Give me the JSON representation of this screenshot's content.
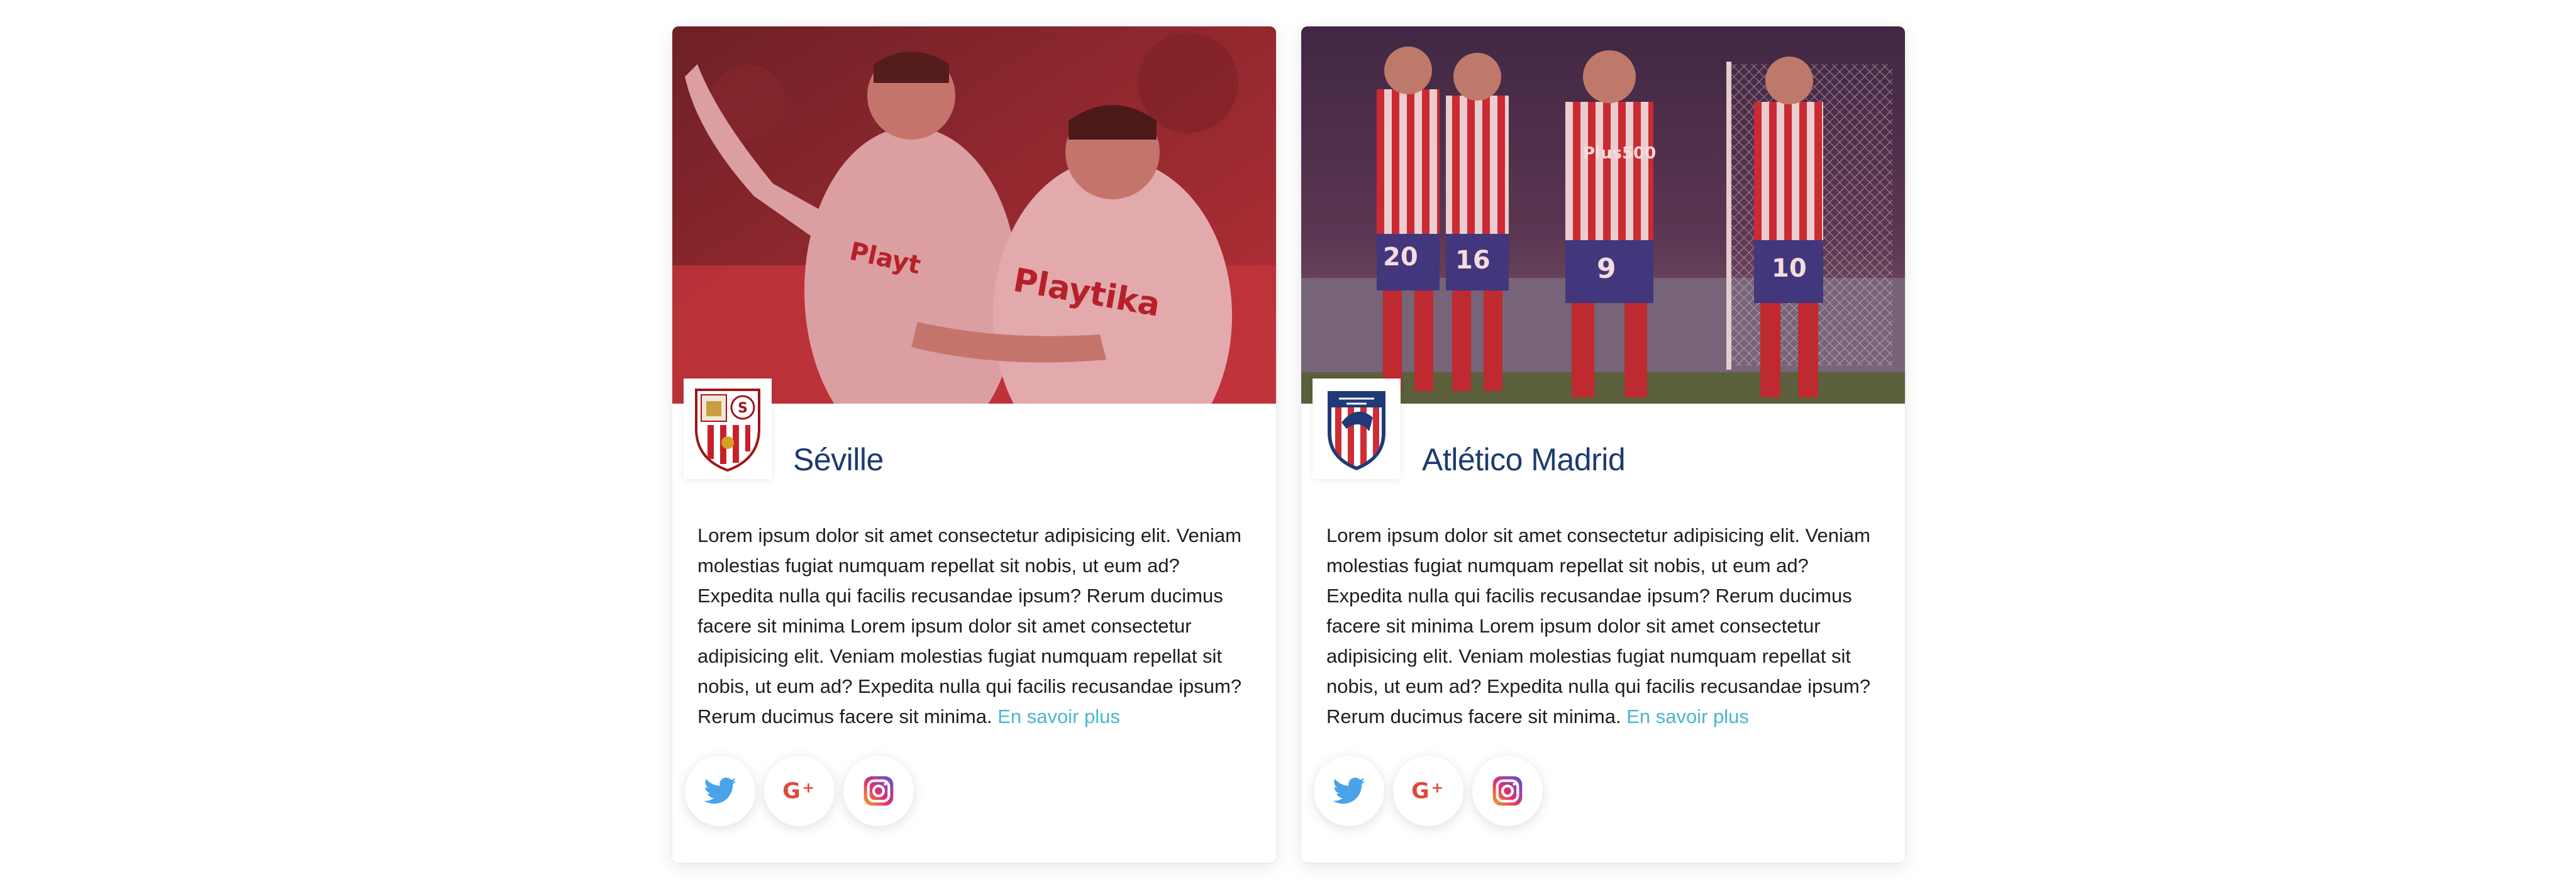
{
  "cards": [
    {
      "team": "Séville",
      "description": "Lorem ipsum dolor sit amet consectetur adipisicing elit. Veniam molestias fugiat numquam repellat sit nobis, ut eum ad? Expedita nulla qui facilis recusandae ipsum? Rerum ducimus facere sit minima Lorem ipsum dolor sit amet consectetur adipisicing elit. Veniam molestias fugiat numquam repellat sit nobis, ut eum ad? Expedita nulla qui facilis recusandae ipsum? Rerum ducimus facere sit minima. ",
      "more_link": "En savoir plus",
      "jersey_text": "Playtika",
      "socials": [
        "twitter-icon",
        "google-plus-icon",
        "instagram-icon"
      ]
    },
    {
      "team": "Atlético Madrid",
      "description": "Lorem ipsum dolor sit amet consectetur adipisicing elit. Veniam molestias fugiat numquam repellat sit nobis, ut eum ad? Expedita nulla qui facilis recusandae ipsum? Rerum ducimus facere sit minima Lorem ipsum dolor sit amet consectetur adipisicing elit. Veniam molestias fugiat numquam repellat sit nobis, ut eum ad? Expedita nulla qui facilis recusandae ipsum? Rerum ducimus facere sit minima. ",
      "more_link": "En savoir plus",
      "jersey_text": "Plus500",
      "jersey_numbers": [
        "20",
        "16",
        "9",
        "10"
      ],
      "socials": [
        "twitter-icon",
        "google-plus-icon",
        "instagram-icon"
      ]
    }
  ],
  "colors": {
    "team_name": "#1e3a70",
    "link": "#4ab6cf",
    "hero_tint": "#b8242c",
    "twitter": "#4aa3e8",
    "google_plus": "#dd4b39"
  }
}
